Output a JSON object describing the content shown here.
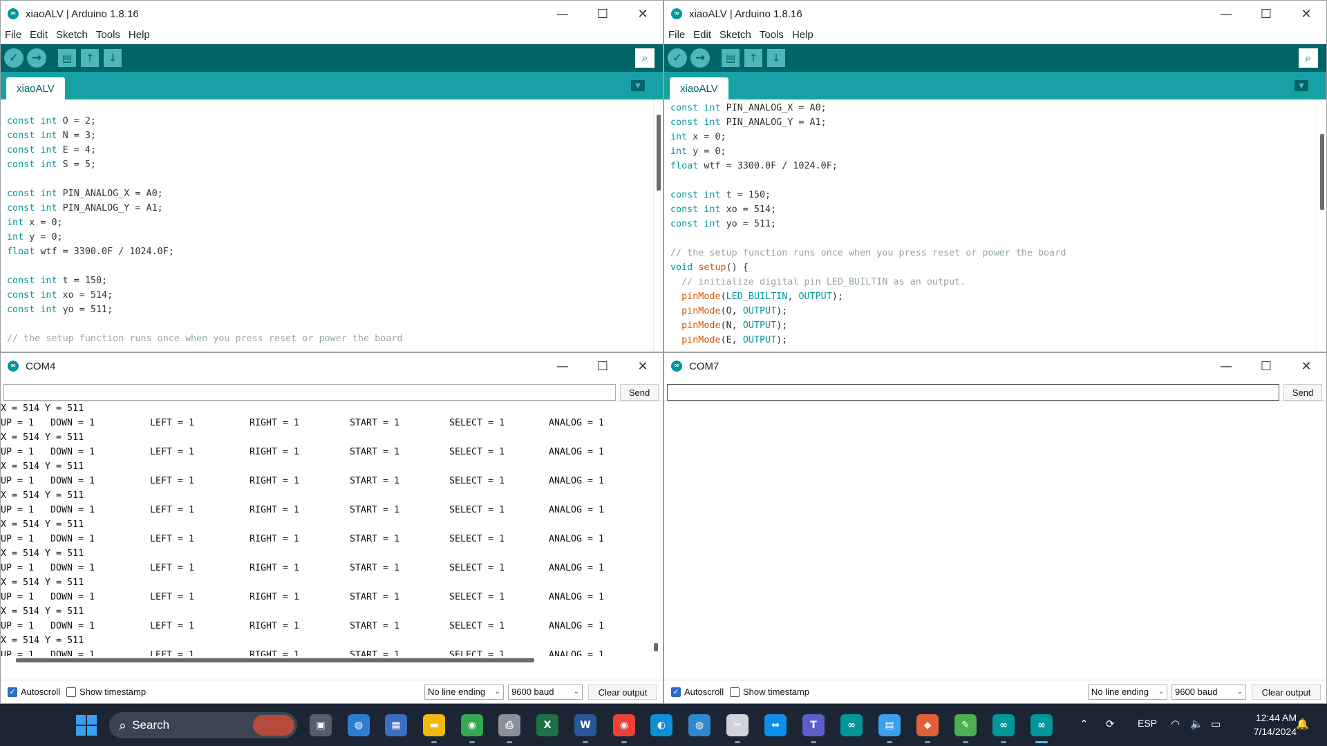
{
  "windows": {
    "left_ide": {
      "title": "xiaoALV | Arduino 1.8.16",
      "menu": [
        "File",
        "Edit",
        "Sketch",
        "Tools",
        "Help"
      ],
      "tab": "xiaoALV"
    },
    "right_ide": {
      "title": "xiaoALV | Arduino 1.8.16",
      "menu": [
        "File",
        "Edit",
        "Sketch",
        "Tools",
        "Help"
      ],
      "tab": "xiaoALV"
    },
    "left_serial": {
      "title": "COM4",
      "send_label": "Send",
      "input_value": "",
      "autoscroll_label": "Autoscroll",
      "autoscroll_checked": true,
      "timestamp_label": "Show timestamp",
      "timestamp_checked": false,
      "line_ending": "No line ending",
      "baud": "9600 baud",
      "clear_label": "Clear output"
    },
    "right_serial": {
      "title": "COM7",
      "send_label": "Send",
      "input_value": "",
      "autoscroll_label": "Autoscroll",
      "autoscroll_checked": true,
      "timestamp_label": "Show timestamp",
      "timestamp_checked": false,
      "line_ending": "No line ending",
      "baud": "9600 baud",
      "clear_label": "Clear output"
    }
  },
  "code_left": [
    "",
    "const int O = 2;",
    "const int N = 3;",
    "const int E = 4;",
    "const int S = 5;",
    "",
    "const int PIN_ANALOG_X = A0;",
    "const int PIN_ANALOG_Y = A1;",
    "int x = 0;",
    "int y = 0;",
    "float wtf = 3300.0F / 1024.0F;",
    "",
    "const int t = 150;",
    "const int xo = 514;",
    "const int yo = 511;",
    "",
    "// the setup function runs once when you press reset or power the board"
  ],
  "code_right": [
    "const int PIN_ANALOG_X = A0;",
    "const int PIN_ANALOG_Y = A1;",
    "int x = 0;",
    "int y = 0;",
    "float wtf = 3300.0F / 1024.0F;",
    "",
    "const int t = 150;",
    "const int xo = 514;",
    "const int yo = 511;",
    "",
    "// the setup function runs once when you press reset or power the board",
    "void setup() {",
    "  // initialize digital pin LED_BUILTIN as an output.",
    "  pinMode(LED_BUILTIN, OUTPUT);",
    "  pinMode(O, OUTPUT);",
    "  pinMode(N, OUTPUT);",
    "  pinMode(E, OUTPUT);"
  ],
  "serial_xy_line": "X = 514 Y = 511",
  "serial_btn_line": [
    "UP = 1",
    "DOWN = 1",
    "LEFT = 1",
    "RIGHT = 1",
    "START = 1",
    "SELECT = 1",
    "ANALOG = 1"
  ],
  "serial_pair_count": 9,
  "taskbar": {
    "search_placeholder": "Search",
    "tray_lang": "ESP",
    "time": "12:44 AM",
    "date": "7/14/2024",
    "apps": [
      {
        "name": "task-view-icon",
        "color": "#555d6b"
      },
      {
        "name": "browser-globe-icon",
        "color": "#2d7dd2"
      },
      {
        "name": "remote-desktop-icon",
        "color": "#3b6fc4"
      },
      {
        "name": "file-explorer-icon",
        "color": "#f2b90c"
      },
      {
        "name": "chrome-icon",
        "color": "#34a853"
      },
      {
        "name": "printer-icon",
        "color": "#8a8f98"
      },
      {
        "name": "excel-icon",
        "color": "#1e7145"
      },
      {
        "name": "word-icon",
        "color": "#2b579a"
      },
      {
        "name": "chrome-profile-icon",
        "color": "#ea4335"
      },
      {
        "name": "edge-icon",
        "color": "#0f8fd6"
      },
      {
        "name": "map-globe-icon",
        "color": "#2f88d0"
      },
      {
        "name": "snipping-tool-icon",
        "color": "#d0d4da"
      },
      {
        "name": "teamviewer-icon",
        "color": "#0e8ee9"
      },
      {
        "name": "teams-icon",
        "color": "#5b5fc7"
      },
      {
        "name": "arduino-icon",
        "color": "#00979c"
      },
      {
        "name": "notepad-icon",
        "color": "#3aa0f0"
      },
      {
        "name": "git-icon",
        "color": "#e0603a"
      },
      {
        "name": "paint-icon",
        "color": "#4caf50"
      },
      {
        "name": "arduino-ide-icon",
        "color": "#00979c"
      },
      {
        "name": "arduino-active-icon",
        "color": "#00979c"
      }
    ]
  }
}
